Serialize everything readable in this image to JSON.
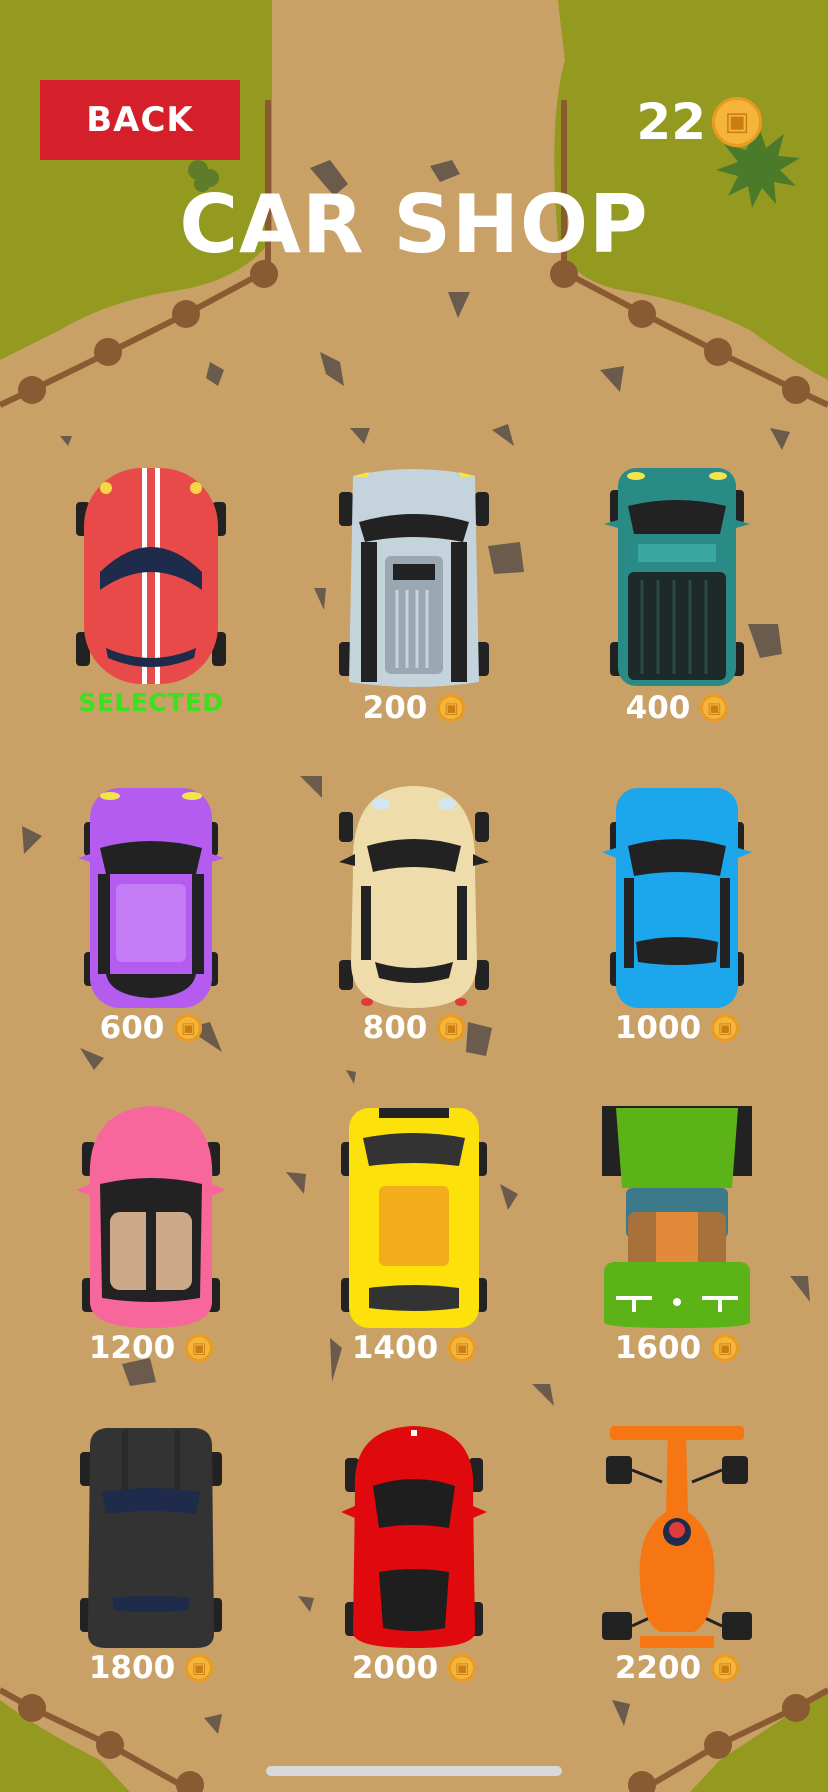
{
  "header": {
    "back_label": "BACK",
    "coin_count": "22",
    "coin_icon": "coin-icon",
    "title": "CAR SHOP"
  },
  "colors": {
    "grass": "#939a1f",
    "dirt": "#c9a066",
    "back_button": "#d51f2a",
    "selected_text": "#3be01f",
    "coin": "#f5b53b"
  },
  "cars": [
    {
      "id": "red-sport",
      "color": "#e84a4a",
      "selected": true,
      "status": "SELECTED",
      "price": ""
    },
    {
      "id": "silver-truck",
      "color": "#c5d3dc",
      "selected": false,
      "status": "",
      "price": "200"
    },
    {
      "id": "teal-pickup",
      "color": "#2a8b86",
      "selected": false,
      "status": "",
      "price": "400"
    },
    {
      "id": "purple-hatch",
      "color": "#b55cf0",
      "selected": false,
      "status": "",
      "price": "600"
    },
    {
      "id": "beige-beetle",
      "color": "#eedcaa",
      "selected": false,
      "status": "",
      "price": "800"
    },
    {
      "id": "blue-sedan",
      "color": "#1ca6ec",
      "selected": false,
      "status": "",
      "price": "1000"
    },
    {
      "id": "pink-convertible",
      "color": "#f7679c",
      "selected": false,
      "status": "",
      "price": "1200"
    },
    {
      "id": "yellow-taxi",
      "color": "#fde10b",
      "selected": false,
      "status": "",
      "price": "1400"
    },
    {
      "id": "green-tractor",
      "color": "#5cb317",
      "selected": false,
      "status": "",
      "price": "1600"
    },
    {
      "id": "black-muscle",
      "color": "#333333",
      "selected": false,
      "status": "",
      "price": "1800"
    },
    {
      "id": "red-supercar",
      "color": "#e0090d",
      "selected": false,
      "status": "",
      "price": "2000"
    },
    {
      "id": "orange-formula",
      "color": "#f77614",
      "selected": false,
      "status": "",
      "price": "2200"
    }
  ]
}
